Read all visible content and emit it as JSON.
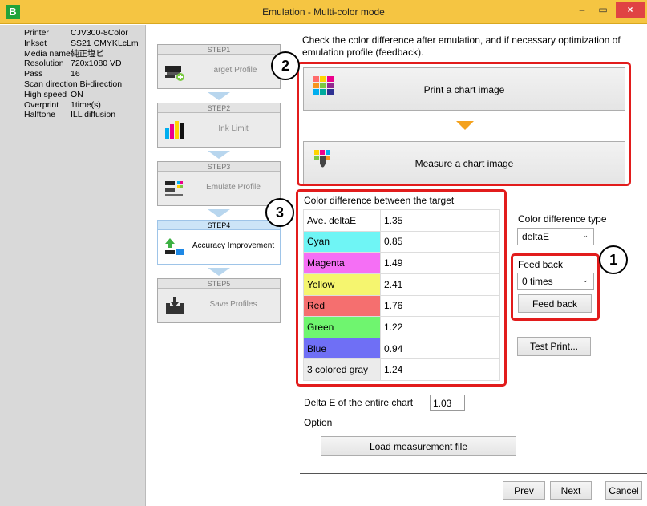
{
  "window": {
    "title": "Emulation - Multi-color mode",
    "app_icon": "B",
    "minimize": "–",
    "maximize": "▭",
    "close": "×"
  },
  "info": [
    {
      "key": "Printer",
      "value": "CJV300-8Color"
    },
    {
      "key": "Inkset",
      "value": "SS21 CMYKLcLm"
    },
    {
      "key": "Media name",
      "value": "純正塩ビ"
    },
    {
      "key": "Resolution",
      "value": "720x1080 VD"
    },
    {
      "key": "Pass",
      "value": "16"
    },
    {
      "key": "Scan direction",
      "value": "Bi-direction"
    },
    {
      "key": "High speed",
      "value": "ON"
    },
    {
      "key": "Overprint",
      "value": "1time(s)"
    },
    {
      "key": "Halftone",
      "value": "ILL diffusion"
    }
  ],
  "steps": [
    {
      "head": "STEP1",
      "label": "Target Profile",
      "icon": "printer-icon",
      "active": false
    },
    {
      "head": "STEP2",
      "label": "Ink Limit",
      "icon": "ink-bars-icon",
      "active": false
    },
    {
      "head": "STEP3",
      "label": "Emulate Profile",
      "icon": "emulate-icon",
      "active": false
    },
    {
      "head": "STEP4",
      "label": "Accuracy Improvement",
      "icon": "upload-icon",
      "active": true
    },
    {
      "head": "STEP5",
      "label": "Save Profiles",
      "icon": "save-tray-icon",
      "active": false
    }
  ],
  "instruction": "Check the color difference after emulation, and if necessary optimization of emulation profile (feedback).",
  "print_chart_label": "Print a chart image",
  "measure_chart_label": "Measure a chart image",
  "callouts": {
    "one": "1",
    "two": "2",
    "three": "3"
  },
  "diff_title": "Color difference between the target",
  "diff_rows": [
    {
      "name": "Ave. deltaE",
      "value": "1.35",
      "color": "#ffffff"
    },
    {
      "name": "Cyan",
      "value": "0.85",
      "color": "#6ff5f5"
    },
    {
      "name": "Magenta",
      "value": "1.49",
      "color": "#f56ff5"
    },
    {
      "name": "Yellow",
      "value": "2.41",
      "color": "#f5f56f"
    },
    {
      "name": "Red",
      "value": "1.76",
      "color": "#f56f6f"
    },
    {
      "name": "Green",
      "value": "1.22",
      "color": "#6ff56f"
    },
    {
      "name": "Blue",
      "value": "0.94",
      "color": "#6f6ff5"
    },
    {
      "name": "3 colored gray",
      "value": "1.24",
      "color": "#ebebeb"
    }
  ],
  "diff_type_label": "Color difference type",
  "diff_type_value": "deltaE",
  "feedback_label": "Feed back",
  "feedback_times": "0 times",
  "feedback_button": "Feed back",
  "test_print_button": "Test Print...",
  "delta_entire_label": "Delta E of the entire chart",
  "delta_entire_value": "1.03",
  "option_label": "Option",
  "load_button": "Load measurement file",
  "prev_button": "Prev",
  "next_button": "Next",
  "cancel_button": "Cancel",
  "colors": {
    "title_bar": "#f5c542",
    "highlight": "#e21c1c",
    "arrow": "#f4a21e",
    "active_step": "#cce4f7"
  }
}
